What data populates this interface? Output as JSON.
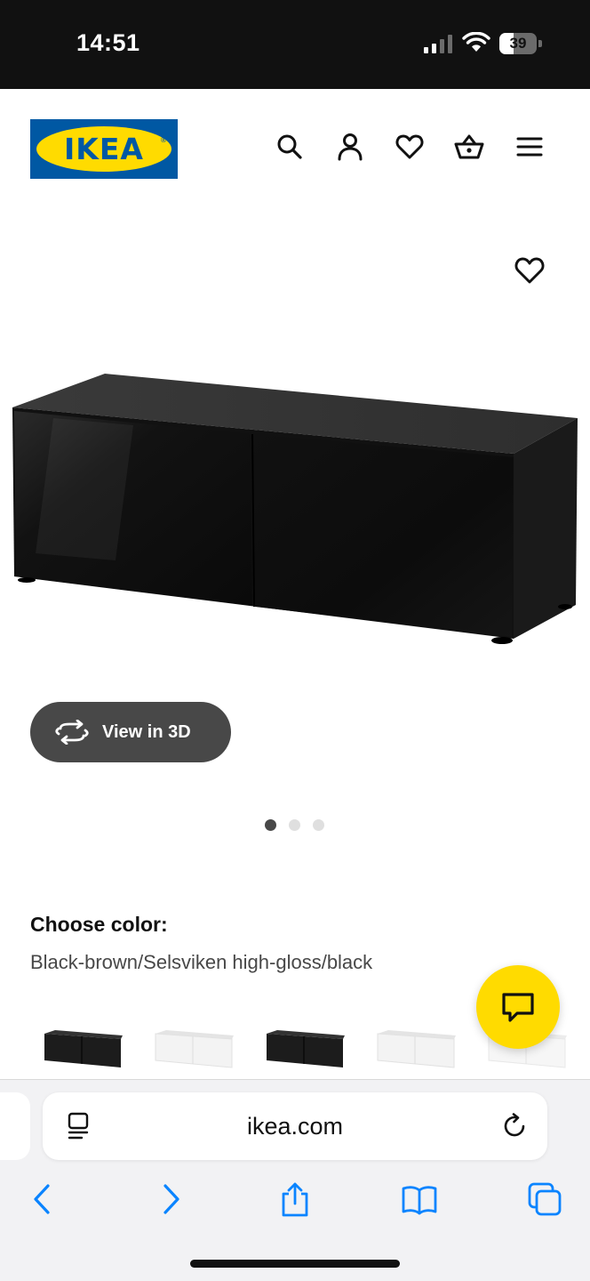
{
  "status_bar": {
    "time": "14:51",
    "battery_level": "39",
    "battery_fraction": 0.39
  },
  "header": {
    "logo_text": "IKEA",
    "logo_registered": "®",
    "logo_colors": {
      "blue": "#0058a3",
      "yellow": "#ffdb00"
    },
    "icons": [
      "search-icon",
      "account-icon",
      "favorites-icon",
      "shopping-basket-icon",
      "menu-icon"
    ]
  },
  "product": {
    "favorite_icon": "heart-outline-icon",
    "image_alt": "Black-brown TV bench with two high-gloss black doors",
    "view3d_label": "View in 3D",
    "carousel": {
      "total": 3,
      "active_index": 0
    }
  },
  "color_choice": {
    "title": "Choose color:",
    "selected": "Black-brown/Selsviken high-gloss/black",
    "swatches": [
      {
        "name": "black-brown",
        "color": "#1c1c1c"
      },
      {
        "name": "white",
        "color": "#f2f2f2"
      },
      {
        "name": "black-brown-2",
        "color": "#1c1c1c"
      },
      {
        "name": "white-2",
        "color": "#f2f2f2"
      },
      {
        "name": "white-3",
        "color": "#f4f4f4"
      }
    ]
  },
  "chat_button": {
    "icon": "chat-bubble-icon",
    "color": "#ffdb00"
  },
  "browser": {
    "url": "ikea.com",
    "accent_color": "#0a84ff",
    "toolbar_icons": [
      "back-icon",
      "forward-icon",
      "share-icon",
      "bookmarks-icon",
      "tabs-icon"
    ]
  }
}
